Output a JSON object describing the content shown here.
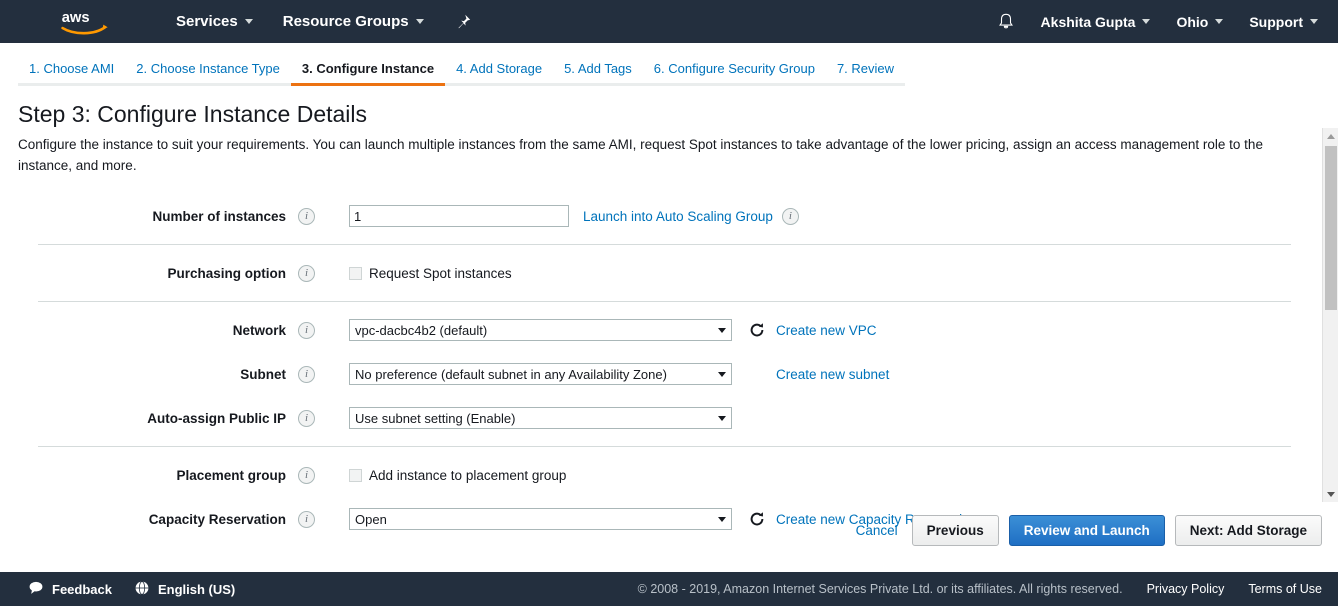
{
  "topnav": {
    "logo_alt": "aws",
    "services_label": "Services",
    "resource_groups_label": "Resource Groups",
    "pin_icon": "pin-icon",
    "bell_icon": "bell-icon",
    "user_label": "Akshita Gupta",
    "region_label": "Ohio",
    "support_label": "Support"
  },
  "steps": [
    {
      "label": "1. Choose AMI",
      "active": false
    },
    {
      "label": "2. Choose Instance Type",
      "active": false
    },
    {
      "label": "3. Configure Instance",
      "active": true
    },
    {
      "label": "4. Add Storage",
      "active": false
    },
    {
      "label": "5. Add Tags",
      "active": false
    },
    {
      "label": "6. Configure Security Group",
      "active": false
    },
    {
      "label": "7. Review",
      "active": false
    }
  ],
  "page": {
    "title": "Step 3: Configure Instance Details",
    "description": "Configure the instance to suit your requirements. You can launch multiple instances from the same AMI, request Spot instances to take advantage of the lower pricing, assign an access management role to the instance, and more."
  },
  "form": {
    "number_of_instances": {
      "label": "Number of instances",
      "value": "1",
      "link_label": "Launch into Auto Scaling Group"
    },
    "purchasing_option": {
      "label": "Purchasing option",
      "checkbox_label": "Request Spot instances",
      "checked": false
    },
    "network": {
      "label": "Network",
      "value": "vpc-dacbc4b2 (default)",
      "link_label": "Create new VPC"
    },
    "subnet": {
      "label": "Subnet",
      "value": "No preference (default subnet in any Availability Zone)",
      "link_label": "Create new subnet"
    },
    "auto_assign_public_ip": {
      "label": "Auto-assign Public IP",
      "value": "Use subnet setting (Enable)"
    },
    "placement_group": {
      "label": "Placement group",
      "checkbox_label": "Add instance to placement group",
      "checked": false
    },
    "capacity_reservation": {
      "label": "Capacity Reservation",
      "value": "Open",
      "link_label": "Create new Capacity Reservation"
    }
  },
  "actions": {
    "cancel_label": "Cancel",
    "previous_label": "Previous",
    "review_label": "Review and Launch",
    "next_label": "Next: Add Storage"
  },
  "footer": {
    "feedback_label": "Feedback",
    "language_label": "English (US)",
    "copyright": "© 2008 - 2019, Amazon Internet Services Private Ltd. or its affiliates. All rights reserved.",
    "privacy_label": "Privacy Policy",
    "terms_label": "Terms of Use"
  },
  "colors": {
    "nav_bg": "#232f3e",
    "accent_orange": "#ec7211",
    "link_blue": "#0073bb",
    "primary_button": "#1f6fc4"
  }
}
